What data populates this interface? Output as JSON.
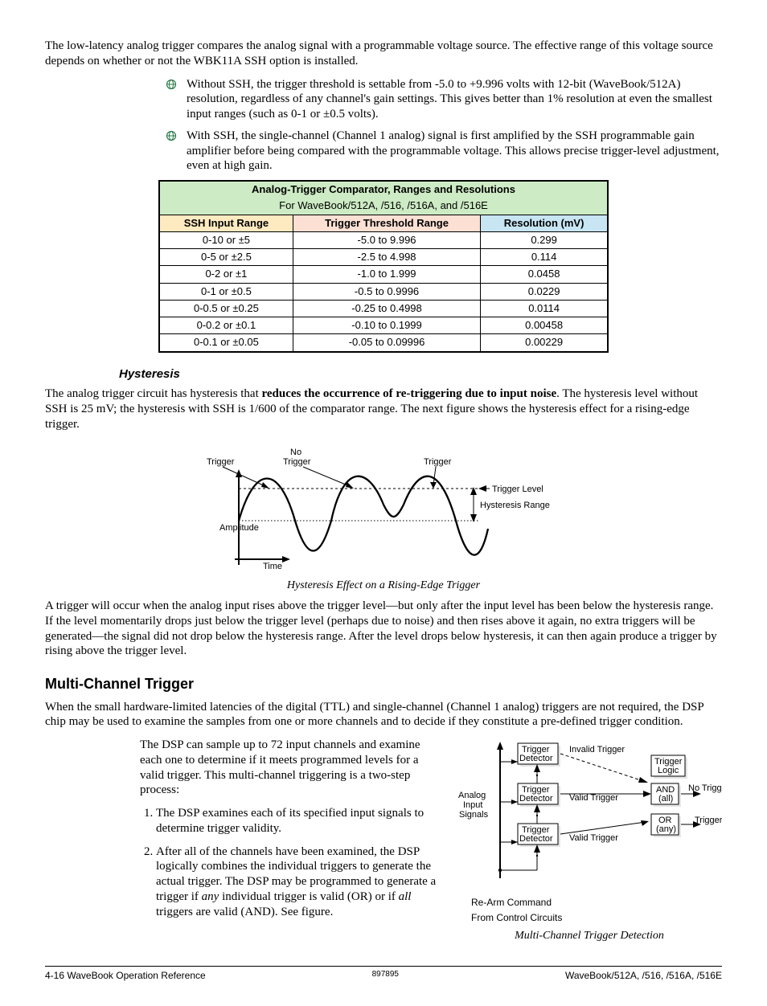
{
  "intro": {
    "p1": "The low-latency analog trigger compares the analog signal with a programmable voltage source.  The effective range of this voltage source depends on whether or not the WBK11A SSH option is installed.",
    "b1": "Without SSH, the trigger threshold is settable from -5.0 to +9.996 volts with 12-bit (WaveBook/512A) resolution, regardless of any channel's gain settings.  This gives better than 1% resolution at even the smallest input ranges (such as 0-1 or ±0.5 volts).",
    "b2": "With SSH, the single-channel (Channel 1 analog) signal is first amplified by the SSH programmable gain amplifier before being compared with the programmable voltage.  This allows precise trigger-level adjustment, even at high gain."
  },
  "table": {
    "title": "Analog-Trigger Comparator, Ranges and Resolutions",
    "subtitle": "For WaveBook/512A, /516, /516A, and /516E",
    "h1": "SSH Input Range",
    "h2": "Trigger Threshold Range",
    "h3": "Resolution (mV)",
    "rows": [
      {
        "a": "0-10 or ±5",
        "b": "-5.0  to  9.996",
        "c": "0.299"
      },
      {
        "a": "0-5 or ±2.5",
        "b": "-2.5  to  4.998",
        "c": "0.114"
      },
      {
        "a": "0-2 or ±1",
        "b": "-1.0  to  1.999",
        "c": "0.0458"
      },
      {
        "a": "0-1 or ±0.5",
        "b": "-0.5  to  0.9996",
        "c": "0.0229"
      },
      {
        "a": "0-0.5 or ±0.25",
        "b": "-0.25  to  0.4998",
        "c": "0.0114"
      },
      {
        "a": "0-0.2 or ±0.1",
        "b": "-0.10  to  0.1999",
        "c": "0.00458"
      },
      {
        "a": "0-0.1 or ±0.05",
        "b": "-0.05  to  0.09996",
        "c": "0.00229"
      }
    ]
  },
  "hysteresis": {
    "heading": "Hysteresis",
    "p1a": "The analog trigger circuit has hysteresis that ",
    "p1b": "reduces the occurrence of re-triggering due to input noise",
    "p1c": ".  The hysteresis level without SSH is 25 mV; the hysteresis with SSH is 1/600 of the comparator range.  The next figure shows the hysteresis effect for a rising-edge trigger.",
    "labels": {
      "trigger1": "Trigger",
      "notrigger_no": "No",
      "notrigger_t": "Trigger",
      "trigger2": "Trigger",
      "triggerLevel": "Trigger Level",
      "hystRange": "Hysteresis Range",
      "amplitude": "Amplitude",
      "time": "Time"
    },
    "caption": "Hysteresis Effect on a Rising-Edge Trigger",
    "p2": "A trigger will occur when the analog input rises above the trigger level—but only after the input level has been below the hysteresis range.  If the level momentarily drops just below the trigger level (perhaps due to noise) and then rises above it again, no extra triggers will be generated—the signal did not drop below the hysteresis range.  After the level drops below hysteresis, it can then again produce a trigger by rising above the trigger level."
  },
  "multi": {
    "heading": "Multi-Channel Trigger",
    "p1": "When the small hardware-limited latencies of the digital (TTL) and single-channel (Channel 1 analog) triggers are not required, the DSP chip may be used to examine the samples from one or more channels and to decide if they constitute a pre-defined trigger condition.",
    "p2": "The DSP can sample up to 72 input channels and examine each one to determine if it meets programmed levels for a valid trigger.  This multi-channel triggering is a two-step process:",
    "s1": "The DSP examines each of its specified input signals to determine trigger validity.",
    "s2a": "After all of the channels have been examined, the DSP logically combines the individual triggers to generate the actual trigger.  The DSP may be programmed to generate a trigger if ",
    "s2any": "any",
    "s2b": " individual trigger is valid (OR) or if ",
    "s2all": "all",
    "s2c": " triggers are valid (AND).  See figure.",
    "diagram": {
      "det": "Trigger\nDetector",
      "invalid": "Invalid Trigger",
      "valid": "Valid Trigger",
      "logic": "Trigger\nLogic",
      "and": "AND\n(all)",
      "or": "OR\n(any)",
      "notrig": "No Trigger",
      "trig": "Trigger",
      "analog": "Analog\nInput\nSignals",
      "rearm1": "Re-Arm Command",
      "rearm2": "From Control Circuits"
    },
    "caption": "Multi-Channel Trigger Detection"
  },
  "footer": {
    "left": "4-16    WaveBook Operation Reference",
    "mid": "897895",
    "right": "WaveBook/512A, /516, /516A, /516E"
  }
}
